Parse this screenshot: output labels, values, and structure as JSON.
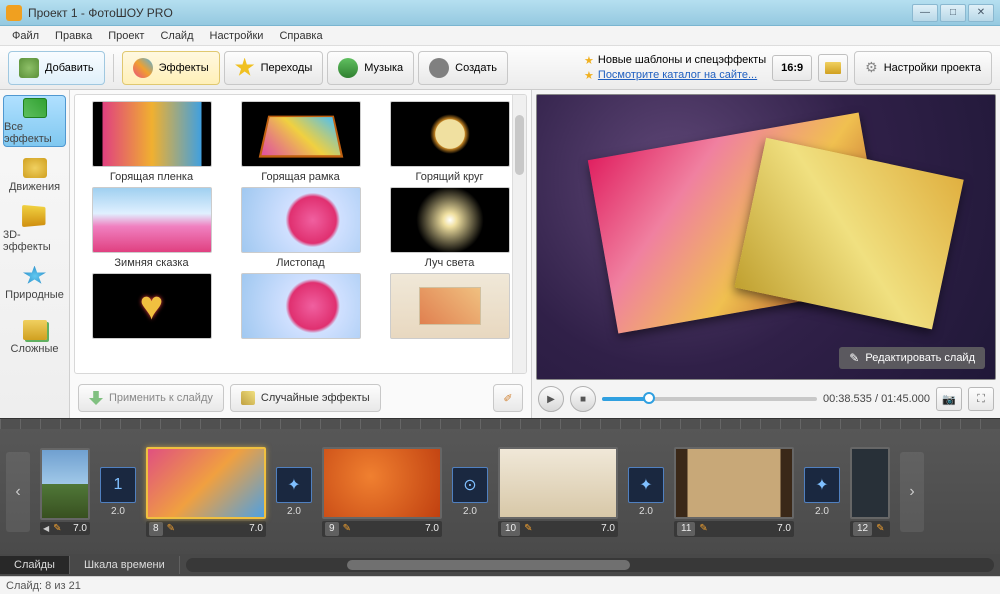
{
  "title": "Проект 1 - ФотоШОУ PRO",
  "menu": [
    "Файл",
    "Правка",
    "Проект",
    "Слайд",
    "Настройки",
    "Справка"
  ],
  "toolbar": {
    "add": "Добавить",
    "effects": "Эффекты",
    "transitions": "Переходы",
    "music": "Музыка",
    "create": "Создать",
    "ratio": "16:9",
    "settings": "Настройки проекта"
  },
  "promo": {
    "line1": "Новые шаблоны и спецэффекты",
    "line2": "Посмотрите каталог на сайте..."
  },
  "categories": [
    {
      "id": "all",
      "label": "Все эффекты"
    },
    {
      "id": "move",
      "label": "Движения"
    },
    {
      "id": "3d",
      "label": "3D-эффекты"
    },
    {
      "id": "nat",
      "label": "Природные"
    },
    {
      "id": "comp",
      "label": "Сложные"
    }
  ],
  "effects": [
    {
      "label": "Горящая пленка",
      "cls": "th-film"
    },
    {
      "label": "Горящая рамка",
      "cls": "th-frame"
    },
    {
      "label": "Горящий круг",
      "cls": "th-ring"
    },
    {
      "label": "Зимняя сказка",
      "cls": "th-flower"
    },
    {
      "label": "Листопад",
      "cls": "th-flower2"
    },
    {
      "label": "Луч света",
      "cls": "th-ray"
    },
    {
      "label": "",
      "cls": "th-heart"
    },
    {
      "label": "",
      "cls": "th-flower2"
    },
    {
      "label": "",
      "cls": "th-beige"
    }
  ],
  "actions": {
    "apply": "Применить к слайду",
    "random": "Случайные эффекты"
  },
  "preview": {
    "edit": "Редактировать слайд",
    "time_current": "00:38.535",
    "time_total": "01:45.000"
  },
  "timeline": {
    "slides": [
      {
        "num": "",
        "dur": "7.0",
        "cls": "st-sky",
        "sel": false,
        "partial": true
      },
      {
        "num": "8",
        "dur": "7.0",
        "cls": "st-collage",
        "sel": true
      },
      {
        "num": "9",
        "dur": "7.0",
        "cls": "st-scatter",
        "sel": false
      },
      {
        "num": "10",
        "dur": "7.0",
        "cls": "st-clean",
        "sel": false
      },
      {
        "num": "11",
        "dur": "7.0",
        "cls": "st-film",
        "sel": false
      },
      {
        "num": "12",
        "dur": "",
        "cls": "st-dark",
        "sel": false,
        "partial": true
      }
    ],
    "transitions": [
      {
        "dur": "2.0",
        "glyph": "1"
      },
      {
        "dur": "2.0",
        "glyph": "✦"
      },
      {
        "dur": "2.0",
        "glyph": "⊙"
      },
      {
        "dur": "2.0",
        "glyph": "✦"
      },
      {
        "dur": "2.0",
        "glyph": "✦"
      }
    ],
    "tabs": {
      "slides": "Слайды",
      "scale": "Шкала времени"
    }
  },
  "status": "Слайд: 8 из 21"
}
